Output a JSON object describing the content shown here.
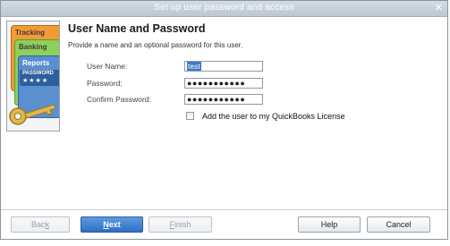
{
  "window": {
    "title": "Set up user password and access",
    "close_glyph": "✕"
  },
  "artwork": {
    "tabs": [
      "Tracking",
      "Banking",
      "Reports"
    ],
    "password_label": "PASSWORD",
    "password_stars": "★★★★",
    "icon": "key-icon"
  },
  "main": {
    "heading": "User Name and Password",
    "subtitle": "Provide a name and an optional password for this user.",
    "fields": [
      {
        "label": "User Name:",
        "value": "test"
      },
      {
        "label": "Password:",
        "value": "●●●●●●●●●●●"
      },
      {
        "label": "Confirm Password:",
        "value": "●●●●●●●●●●●"
      }
    ],
    "license_checkbox": {
      "label": "Add the user to my QuickBooks License",
      "checked": false
    }
  },
  "footer": {
    "back": {
      "pre": "Bac",
      "acc": "k",
      "post": ""
    },
    "next": {
      "pre": "",
      "acc": "N",
      "post": "ext"
    },
    "finish": {
      "pre": "",
      "acc": "F",
      "post": "inish"
    },
    "help": "Help",
    "cancel": "Cancel"
  },
  "colors": {
    "accent": "#2e6fc2",
    "titlebar": "#bcc7d0",
    "tab_tracking": "#f29a33",
    "tab_banking": "#8fcf5b",
    "tab_reports": "#5a8fd0"
  }
}
